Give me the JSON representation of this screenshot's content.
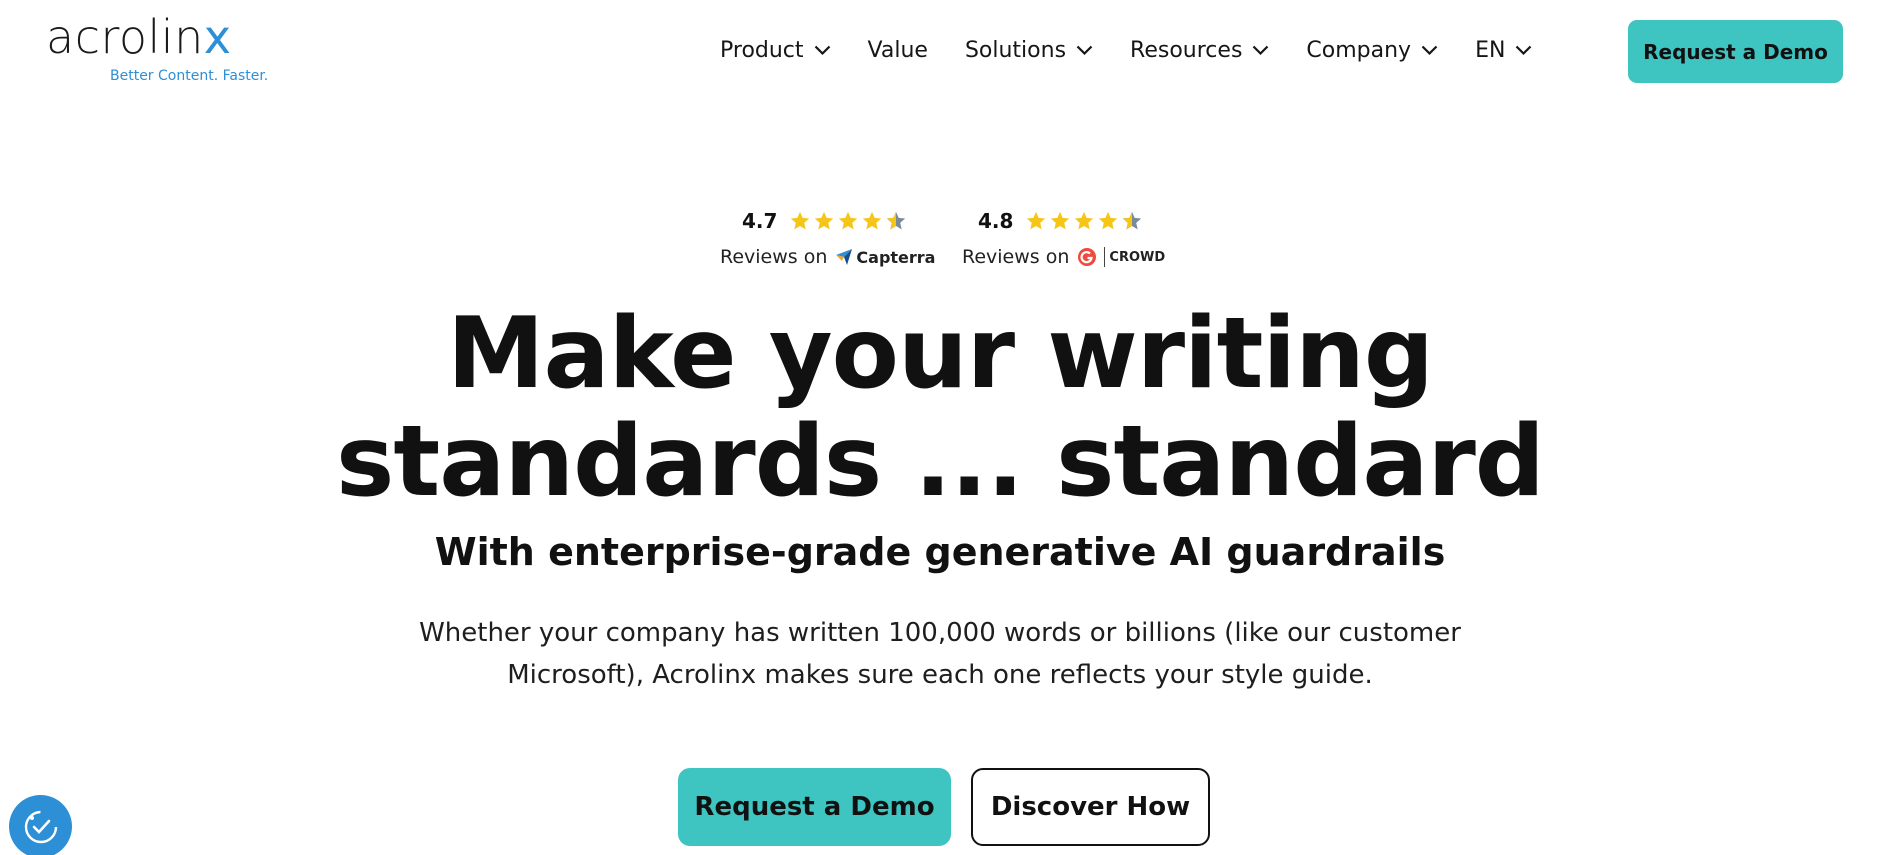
{
  "logo": {
    "wordmark_main": "acrolin",
    "wordmark_x": "x",
    "tagline": "Better Content. Faster.",
    "brand_color": "#2d8fd5"
  },
  "nav": {
    "items": [
      {
        "label": "Product",
        "has_dropdown": true
      },
      {
        "label": "Value",
        "has_dropdown": false
      },
      {
        "label": "Solutions",
        "has_dropdown": true
      },
      {
        "label": "Resources",
        "has_dropdown": true
      },
      {
        "label": "Company",
        "has_dropdown": true
      },
      {
        "label": "EN",
        "has_dropdown": true
      }
    ],
    "cta_label": "Request a Demo"
  },
  "ratings": {
    "capterra": {
      "score": "4.7",
      "stars": 4.5,
      "reviews_text": "Reviews on",
      "brand_name": "Capterra"
    },
    "g2": {
      "score": "4.8",
      "stars": 4.5,
      "reviews_text": "Reviews on",
      "brand_name": "CROWD"
    }
  },
  "hero": {
    "title_line1": "Make your writing",
    "title_line2": "standards ... standard",
    "subtitle": "With enterprise-grade generative AI guardrails",
    "description_line1": "Whether your company has written 100,000 words or billions (like our customer",
    "description_line2": "Microsoft), Acrolinx makes sure each one reflects your style guide.",
    "primary_cta": "Request a Demo",
    "secondary_cta": "Discover How"
  },
  "colors": {
    "accent": "#3ec4c1",
    "star": "#f5c518",
    "text": "#111111"
  },
  "icons": {
    "nav_dropdown": "chevron-down-icon",
    "rating_star": "star-icon",
    "accessibility": "accessibility-icon"
  }
}
